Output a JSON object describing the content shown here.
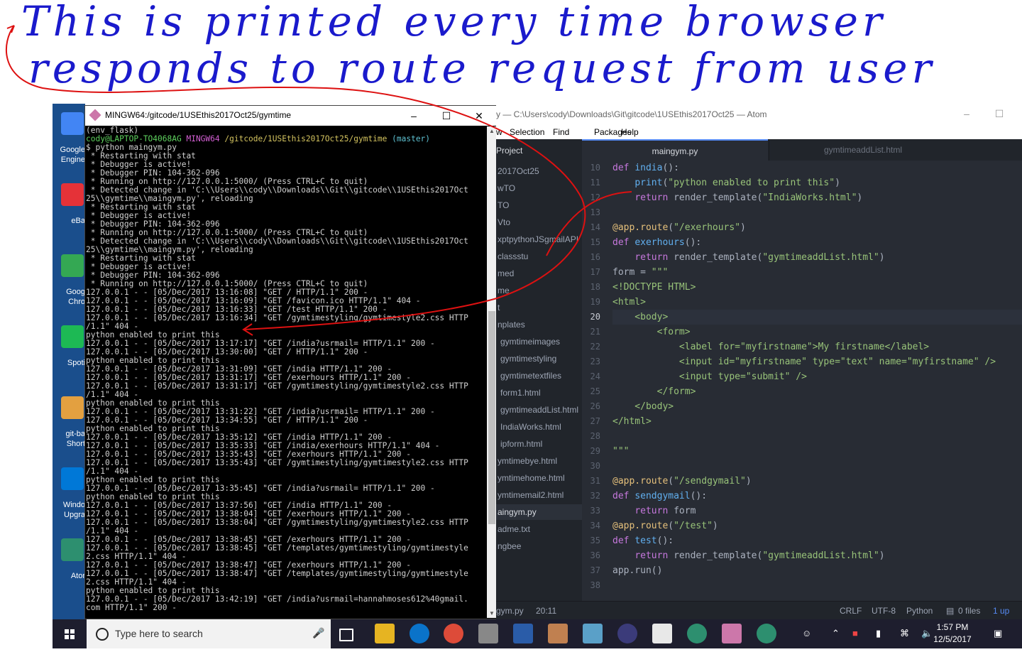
{
  "annotation": {
    "line1": "This is printed every time browser",
    "line2": "responds to route request from user"
  },
  "desktop": {
    "icons": [
      {
        "label1": "Google",
        "label2": "Engine",
        "color": "#4285f4"
      },
      {
        "label1": "eBa",
        "label2": "",
        "color": "#e53238"
      },
      {
        "label1": "Goog",
        "label2": "Chro",
        "color": "#34a853"
      },
      {
        "label1": "Spoti",
        "label2": "",
        "color": "#1db954"
      },
      {
        "label1": "git-ba",
        "label2": "Short",
        "color": "#e3a040"
      },
      {
        "label1": "Windo",
        "label2": "Upgra",
        "color": "#0078d7"
      },
      {
        "label1": "Ator",
        "label2": "",
        "color": "#2d8f6f"
      }
    ]
  },
  "terminal": {
    "title": "MINGW64:/gitcode/1USEthis2017Oct25/gymtime",
    "prompt_env": "(env_flask)",
    "prompt_user": "cody@LAPTOP-TO4068AG",
    "prompt_sys": "MINGW64",
    "prompt_path": "/gitcode/1USEthis2017Oct25/gymtime",
    "prompt_branch": "(master)",
    "lines": [
      "$ python maingym.py",
      " * Restarting with stat",
      " * Debugger is active!",
      " * Debugger PIN: 104-362-096",
      " * Running on http://127.0.0.1:5000/ (Press CTRL+C to quit)",
      " * Detected change in 'C:\\\\Users\\\\cody\\\\Downloads\\\\Git\\\\gitcode\\\\1USEthis2017Oct",
      "25\\\\gymtime\\\\maingym.py', reloading",
      " * Restarting with stat",
      " * Debugger is active!",
      " * Debugger PIN: 104-362-096",
      " * Running on http://127.0.0.1:5000/ (Press CTRL+C to quit)",
      " * Detected change in 'C:\\\\Users\\\\cody\\\\Downloads\\\\Git\\\\gitcode\\\\1USEthis2017Oct",
      "25\\\\gymtime\\\\maingym.py', reloading",
      " * Restarting with stat",
      " * Debugger is active!",
      " * Debugger PIN: 104-362-096",
      " * Running on http://127.0.0.1:5000/ (Press CTRL+C to quit)",
      "127.0.0.1 - - [05/Dec/2017 13:16:08] \"GET / HTTP/1.1\" 200 -",
      "127.0.0.1 - - [05/Dec/2017 13:16:09] \"GET /favicon.ico HTTP/1.1\" 404 -",
      "127.0.0.1 - - [05/Dec/2017 13:16:33] \"GET /test HTTP/1.1\" 200 -",
      "127.0.0.1 - - [05/Dec/2017 13:16:34] \"GET /gymtimestyling/gymtimestyle2.css HTTP",
      "/1.1\" 404 -",
      "python enabled to print this",
      "127.0.0.1 - - [05/Dec/2017 13:17:17] \"GET /india?usrmail= HTTP/1.1\" 200 -",
      "127.0.0.1 - - [05/Dec/2017 13:30:00] \"GET / HTTP/1.1\" 200 -",
      "python enabled to print this",
      "127.0.0.1 - - [05/Dec/2017 13:31:09] \"GET /india HTTP/1.1\" 200 -",
      "127.0.0.1 - - [05/Dec/2017 13:31:17] \"GET /exerhours HTTP/1.1\" 200 -",
      "127.0.0.1 - - [05/Dec/2017 13:31:17] \"GET /gymtimestyling/gymtimestyle2.css HTTP",
      "/1.1\" 404 -",
      "python enabled to print this",
      "127.0.0.1 - - [05/Dec/2017 13:31:22] \"GET /india?usrmail= HTTP/1.1\" 200 -",
      "127.0.0.1 - - [05/Dec/2017 13:34:55] \"GET / HTTP/1.1\" 200 -",
      "python enabled to print this",
      "127.0.0.1 - - [05/Dec/2017 13:35:12] \"GET /india HTTP/1.1\" 200 -",
      "127.0.0.1 - - [05/Dec/2017 13:35:33] \"GET /india/exerhours HTTP/1.1\" 404 -",
      "127.0.0.1 - - [05/Dec/2017 13:35:43] \"GET /exerhours HTTP/1.1\" 200 -",
      "127.0.0.1 - - [05/Dec/2017 13:35:43] \"GET /gymtimestyling/gymtimestyle2.css HTTP",
      "/1.1\" 404 -",
      "python enabled to print this",
      "127.0.0.1 - - [05/Dec/2017 13:35:45] \"GET /india?usrmail= HTTP/1.1\" 200 -",
      "python enabled to print this",
      "127.0.0.1 - - [05/Dec/2017 13:37:56] \"GET /india HTTP/1.1\" 200 -",
      "127.0.0.1 - - [05/Dec/2017 13:38:04] \"GET /exerhours HTTP/1.1\" 200 -",
      "127.0.0.1 - - [05/Dec/2017 13:38:04] \"GET /gymtimestyling/gymtimestyle2.css HTTP",
      "/1.1\" 404 -",
      "127.0.0.1 - - [05/Dec/2017 13:38:45] \"GET /exerhours HTTP/1.1\" 200 -",
      "127.0.0.1 - - [05/Dec/2017 13:38:45] \"GET /templates/gymtimestyling/gymtimestyle",
      "2.css HTTP/1.1\" 404 -",
      "127.0.0.1 - - [05/Dec/2017 13:38:47] \"GET /exerhours HTTP/1.1\" 200 -",
      "127.0.0.1 - - [05/Dec/2017 13:38:47] \"GET /templates/gymtimestyling/gymtimestyle",
      "2.css HTTP/1.1\" 404 -",
      "python enabled to print this",
      "127.0.0.1 - - [05/Dec/2017 13:42:19] \"GET /india?usrmail=hannahmoses612%40gmail.",
      "com HTTP/1.1\" 200 -"
    ]
  },
  "atom": {
    "title": "y — C:\\Users\\cody\\Downloads\\Git\\gitcode\\1USEthis2017Oct25 — Atom",
    "menu": [
      "w",
      "Selection",
      "Find",
      "Packages",
      "Help"
    ],
    "sidebar_head": "Project",
    "sidebar_items": [
      {
        "label": "2017Oct25",
        "indent": 2,
        "sel": false
      },
      {
        "label": "wTO",
        "indent": 2,
        "sel": false
      },
      {
        "label": "TO",
        "indent": 2,
        "sel": false
      },
      {
        "label": "Vto",
        "indent": 2,
        "sel": false
      },
      {
        "label": "xptpythonJSgmailAPI",
        "indent": 2,
        "sel": false
      },
      {
        "label": "classstu",
        "indent": 2,
        "sel": false
      },
      {
        "label": "med",
        "indent": 2,
        "sel": false
      },
      {
        "label": "me",
        "indent": 2,
        "sel": false
      },
      {
        "label": "t",
        "indent": 2,
        "sel": false
      },
      {
        "label": "nplates",
        "indent": 2,
        "sel": false
      },
      {
        "label": "gymtimeimages",
        "indent": 6,
        "sel": false
      },
      {
        "label": "gymtimestyling",
        "indent": 6,
        "sel": false
      },
      {
        "label": "gymtimetextfiles",
        "indent": 6,
        "sel": false
      },
      {
        "label": "form1.html",
        "indent": 6,
        "sel": false
      },
      {
        "label": "gymtimeaddList.html",
        "indent": 6,
        "sel": false
      },
      {
        "label": "IndiaWorks.html",
        "indent": 6,
        "sel": false
      },
      {
        "label": "ipform.html",
        "indent": 6,
        "sel": false
      },
      {
        "label": "ymtimebye.html",
        "indent": 2,
        "sel": false
      },
      {
        "label": "ymtimehome.html",
        "indent": 2,
        "sel": false
      },
      {
        "label": "ymtimemail2.html",
        "indent": 2,
        "sel": false
      },
      {
        "label": "aingym.py",
        "indent": 2,
        "sel": true
      },
      {
        "label": "adme.txt",
        "indent": 2,
        "sel": false
      },
      {
        "label": "ngbee",
        "indent": 2,
        "sel": false
      }
    ],
    "tabs": {
      "active": "maingym.py",
      "inactive": "gymtimeaddList.html"
    },
    "line_numbers": [
      10,
      11,
      12,
      13,
      14,
      15,
      16,
      17,
      18,
      19,
      20,
      21,
      22,
      23,
      24,
      25,
      26,
      27,
      28,
      29,
      30,
      31,
      32,
      33,
      34,
      35,
      36,
      37,
      38
    ],
    "current_line": 20,
    "status": {
      "file": "gym.py",
      "pos": "20:11",
      "eol": "CRLF",
      "enc": "UTF-8",
      "grammar": "Python",
      "files": "0 files",
      "extra": "1 up"
    }
  },
  "taskbar": {
    "search_placeholder": "Type here to search",
    "time": "1:57 PM",
    "date": "12/5/2017"
  }
}
